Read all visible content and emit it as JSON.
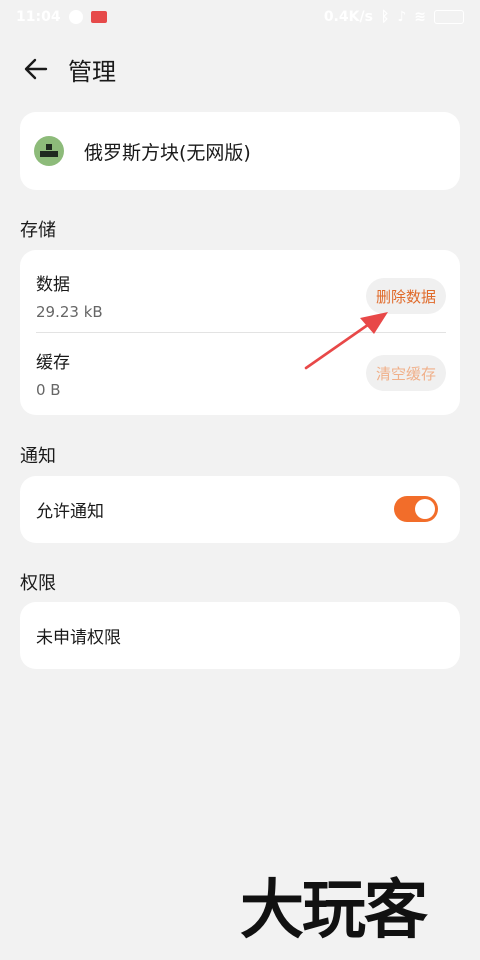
{
  "status_bar": {
    "time": "11:04",
    "speed": "0.4K/s",
    "battery": "72"
  },
  "header": {
    "title": "管理"
  },
  "app": {
    "name": "俄罗斯方块(无网版)"
  },
  "storage": {
    "section_title": "存储",
    "data_label": "数据",
    "data_size": "29.23 kB",
    "delete_label": "删除数据",
    "cache_label": "缓存",
    "cache_size": "0 B",
    "clear_label": "清空缓存"
  },
  "notifications": {
    "section_title": "通知",
    "allow_label": "允许通知",
    "allow_enabled": true
  },
  "permissions": {
    "section_title": "权限",
    "none_label": "未申请权限"
  },
  "watermark": {
    "text": "大玩客"
  },
  "colors": {
    "accent": "#f26d2a",
    "delete_text": "#e06a2a",
    "disabled_text": "#f0b08a",
    "annotation_arrow": "#e84848",
    "background": "#f2f2f2"
  }
}
